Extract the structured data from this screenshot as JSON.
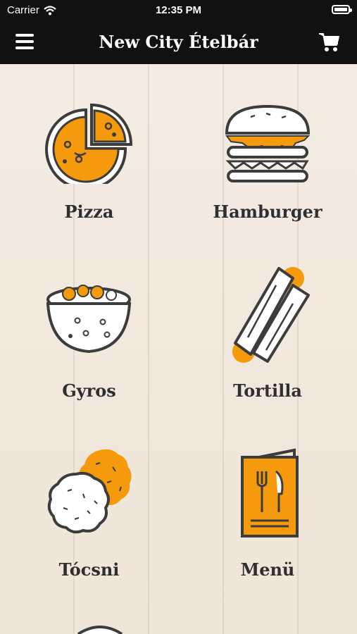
{
  "status_bar": {
    "carrier": "Carrier",
    "time": "12:35 PM"
  },
  "header": {
    "title": "New City Ételbár",
    "menu_icon": "hamburger-menu-icon",
    "cart_icon": "shopping-cart-icon"
  },
  "colors": {
    "bar": "#111111",
    "accent": "#f59a0c",
    "outline": "#3c3c3c",
    "background": "#f1e8dc"
  },
  "categories": [
    {
      "label": "Pizza",
      "icon": "pizza-icon"
    },
    {
      "label": "Hamburger",
      "icon": "hamburger-icon"
    },
    {
      "label": "Gyros",
      "icon": "gyros-icon"
    },
    {
      "label": "Tortilla",
      "icon": "tortilla-icon"
    },
    {
      "label": "Tócsni",
      "icon": "tocsni-icon"
    },
    {
      "label": "Menü",
      "icon": "menu-book-icon"
    }
  ]
}
